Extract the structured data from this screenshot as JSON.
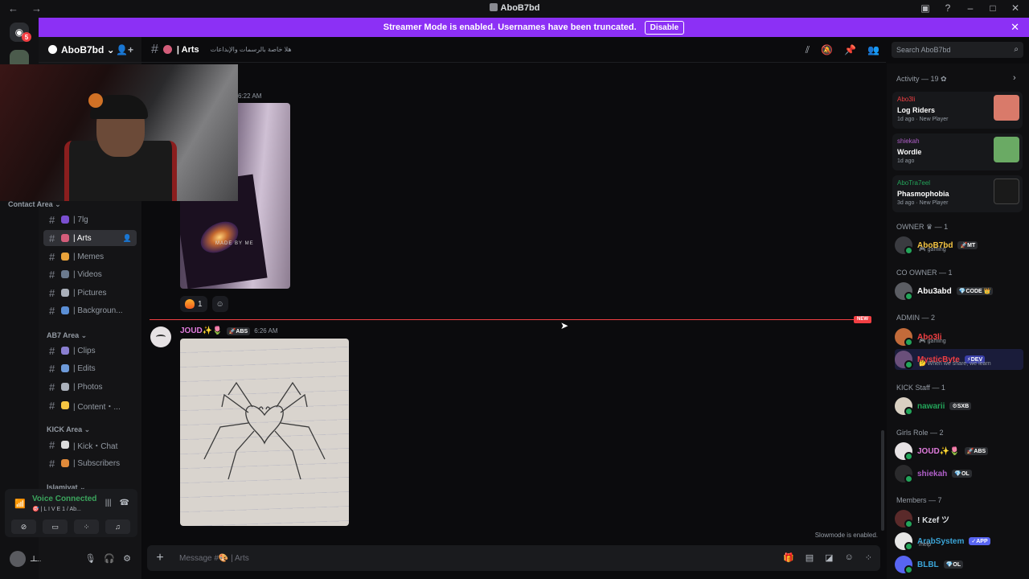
{
  "window": {
    "title": "AboB7bd",
    "nav_back": "←",
    "nav_forward": "→"
  },
  "banner": {
    "text": "Streamer Mode is enabled. Usernames have been truncated.",
    "button": "Disable",
    "close": "✕"
  },
  "rail": {
    "badge": "5"
  },
  "server": {
    "name": "AboB7bd ⌄"
  },
  "categories": [
    {
      "label": "Contact Area ⌄"
    },
    {
      "label": "AB7 Area ⌄"
    },
    {
      "label": "KICK Area ⌄"
    },
    {
      "label": "Islamiyat ⌄"
    }
  ],
  "channels": [
    {
      "label": "| 7lg",
      "color": "#7a4fd0"
    },
    {
      "label": "| Arts",
      "color": "#d35d7a"
    },
    {
      "label": "| Memes",
      "color": "#e8a23a"
    },
    {
      "label": "| Videos",
      "color": "#6b7a8f"
    },
    {
      "label": "| Pictures",
      "color": "#aab0ba"
    },
    {
      "label": "| Backgroun...",
      "color": "#5b8fd6"
    },
    {
      "label": "| Clips",
      "color": "#8a7fd1"
    },
    {
      "label": "| Edits",
      "color": "#6d9ad9"
    },
    {
      "label": "| Photos",
      "color": "#aab0ba"
    },
    {
      "label": "| Content・...",
      "color": "#f5c542"
    },
    {
      "label": "| Kick・Chat",
      "color": "#dcdcdc"
    },
    {
      "label": "| Subscribers",
      "color": "#e08a3a"
    }
  ],
  "topbar": {
    "channel": "| Arts",
    "topic": "هلا خاصة بالرسمات والإبداعات"
  },
  "search": {
    "placeholder": "Search AboB7bd"
  },
  "messages": {
    "first_time": "6:22 AM",
    "made_by": "MADE BY ME",
    "reaction_count": "1",
    "new_badge": "NEW",
    "second": {
      "author": "JOUD✨🌷",
      "tag": "🚀ABS",
      "time": "6:26 AM"
    }
  },
  "slowmode": "Slowmode is enabled.",
  "composer": {
    "placeholder": "Message #🎨 | Arts"
  },
  "voice": {
    "status": "Voice Connected",
    "sub": "🎯 | L I V E 1 / Ab..."
  },
  "user": {
    "name": "ـلـ.."
  },
  "activity": {
    "header": "Activity — 19 ✿",
    "cards": [
      {
        "who": "Abo3li",
        "who_color": "#f23f43",
        "game": "Log Riders",
        "meta": "1d ago · New Player",
        "art": "#d97a6a"
      },
      {
        "who": "shiekah",
        "who_color": "#b05fc9",
        "game": "Wordle",
        "meta": "1d ago",
        "art": "#6aaa64"
      },
      {
        "who": "AboTra7eel",
        "who_color": "#23a55a",
        "game": "Phasmophobia",
        "meta": "3d ago · New Player",
        "art": "#1a1a1a"
      }
    ]
  },
  "roles": [
    {
      "label": "OWNER ♛ — 1"
    },
    {
      "label": "CO OWNER — 1"
    },
    {
      "label": "ADMIN — 2"
    },
    {
      "label": "KICK Staff — 1"
    },
    {
      "label": "Girls Role — 2"
    },
    {
      "label": "Members — 7"
    }
  ],
  "members": [
    {
      "name": "AboB7bd",
      "color": "#f5c542",
      "badge": "🚀MT",
      "sub": "🎮 gaming",
      "ava": "#3a3b40"
    },
    {
      "name": "Abu3abd",
      "color": "#ffffff",
      "badge": "💎CODE 👑",
      "sub": "",
      "ava": "#5b5d63"
    },
    {
      "name": "Abo3li",
      "color": "#f23f43",
      "badge": "",
      "sub": "🎮 gaming",
      "ava": "#c26b3a"
    },
    {
      "name": "MysticByte",
      "color": "#f23f43",
      "badge": "⚡DEV",
      "sub": "🤔 When we share, we learn",
      "ava": "#6a4f7a"
    },
    {
      "name": "nawarii",
      "color": "#23a55a",
      "badge": "⚙SXB",
      "sub": "",
      "ava": "#d9d0c2"
    },
    {
      "name": "JOUD✨🌷",
      "color": "#e07bdc",
      "badge": "🚀ABS",
      "sub": "",
      "ava": "#e6e2e4"
    },
    {
      "name": "shiekah",
      "color": "#b05fc9",
      "badge": "💎OL",
      "sub": "",
      "ava": "#2a2a2c"
    },
    {
      "name": "! Kzef ツ",
      "color": "#dbdee1",
      "badge": "",
      "sub": "",
      "ava": "#5a2a2a"
    },
    {
      "name": "ArabSystem",
      "color": "#3ba5d8",
      "badge": "✓APP",
      "sub": "/help",
      "ava": "#e6e6e6"
    },
    {
      "name": "BLBL",
      "color": "#3ba5d8",
      "badge": "💎OL",
      "sub": "",
      "ava": "#5865f2"
    }
  ]
}
